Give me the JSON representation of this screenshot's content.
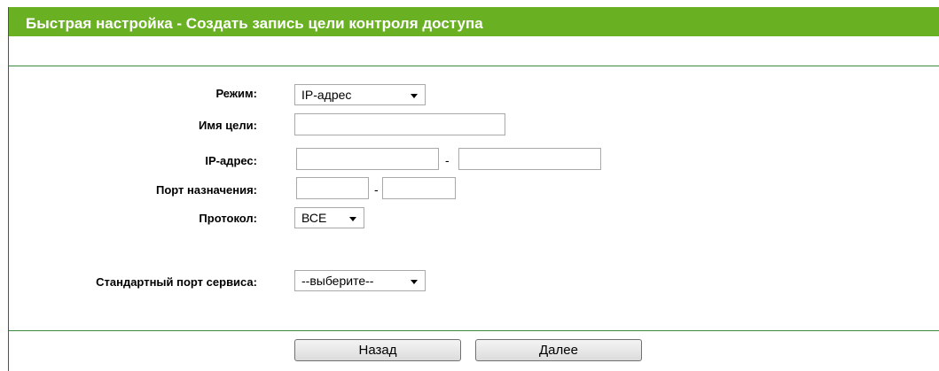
{
  "page": {
    "title": "Быстрая настройка - Создать запись цели контроля доступа"
  },
  "form": {
    "mode_label": "Режим:",
    "mode_value": "IP-адрес",
    "target_name_label": "Имя цели:",
    "target_name_value": "",
    "ip_label": "IP-адрес:",
    "ip_start_value": "",
    "ip_end_value": "",
    "ip_separator": "-",
    "port_label": "Порт назначения:",
    "port_start_value": "",
    "port_end_value": "",
    "port_separator": "-",
    "protocol_label": "Протокол:",
    "protocol_value": "ВСЕ",
    "service_port_label": "Стандартный порт сервиса:",
    "service_port_value": "--выберите--"
  },
  "buttons": {
    "back_label": "Назад",
    "next_label": "Далее"
  },
  "colors": {
    "title_bar": "#6ab023",
    "divider": "#3c8a3c"
  }
}
